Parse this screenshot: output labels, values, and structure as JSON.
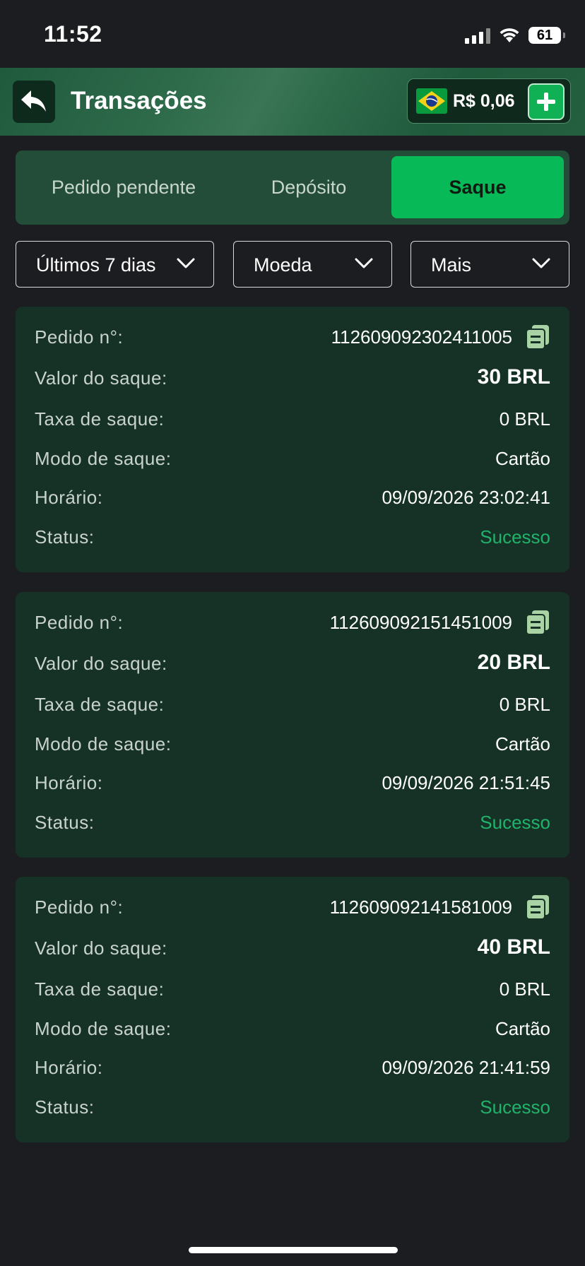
{
  "status_bar": {
    "time": "11:52",
    "battery": "61"
  },
  "header": {
    "title": "Transações",
    "balance": "R$ 0,06"
  },
  "tabs": [
    {
      "label": "Pedido pendente",
      "active": false
    },
    {
      "label": "Depósito",
      "active": false
    },
    {
      "label": "Saque",
      "active": true
    }
  ],
  "filters": {
    "period": "Últimos 7 dias",
    "currency": "Moeda",
    "more": "Mais"
  },
  "labels": {
    "order": "Pedido n°:",
    "amount": "Valor do saque:",
    "fee": "Taxa de saque:",
    "mode": "Modo de saque:",
    "time": "Horário:",
    "status": "Status:"
  },
  "transactions": [
    {
      "order": "112609092302411005",
      "amount": "30 BRL",
      "fee": "0 BRL",
      "mode": "Cartão",
      "time": "09/09/2026 23:02:41",
      "status": "Sucesso"
    },
    {
      "order": "112609092151451009",
      "amount": "20 BRL",
      "fee": "0 BRL",
      "mode": "Cartão",
      "time": "09/09/2026 21:51:45",
      "status": "Sucesso"
    },
    {
      "order": "112609092141581009",
      "amount": "40 BRL",
      "fee": "0 BRL",
      "mode": "Cartão",
      "time": "09/09/2026 21:41:59",
      "status": "Sucesso"
    }
  ],
  "colors": {
    "accent": "#08b957",
    "success": "#20b36a",
    "card": "#163125",
    "background": "#1c1d20"
  }
}
